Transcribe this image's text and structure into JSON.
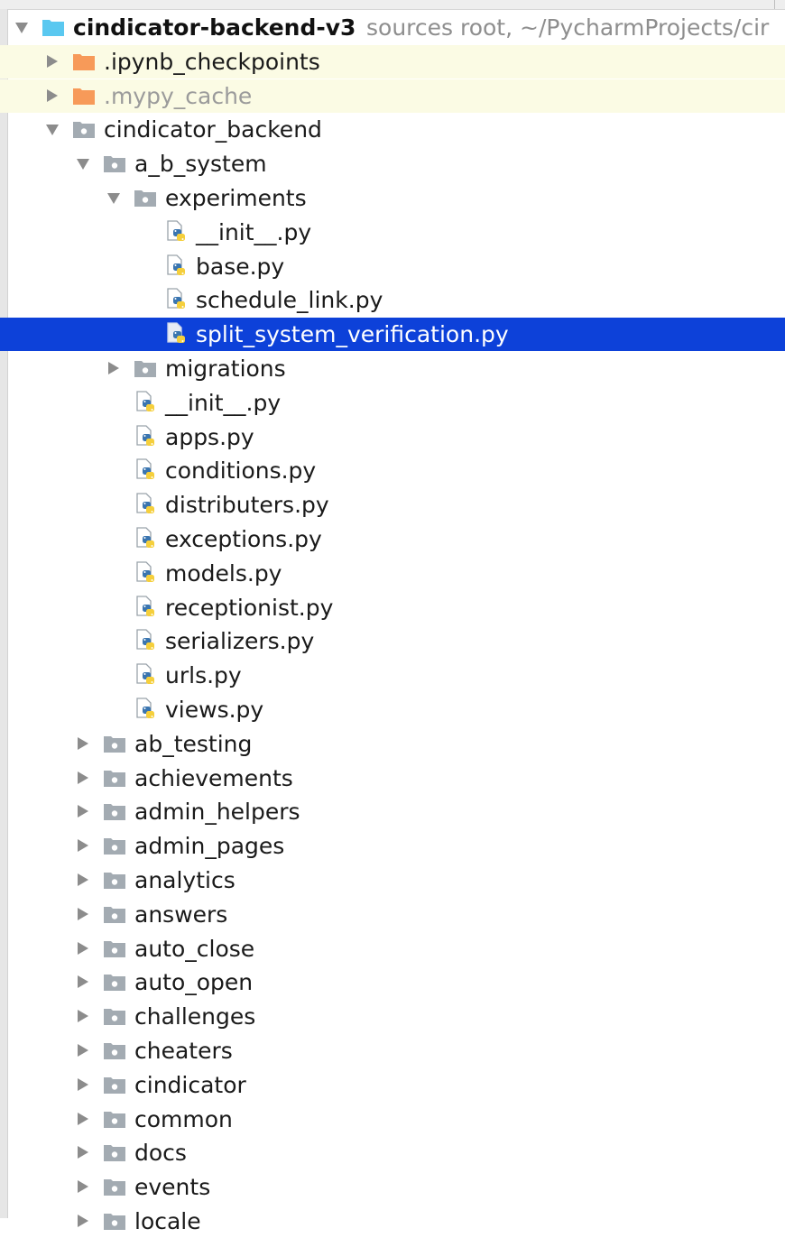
{
  "tree": {
    "rows": [
      {
        "depth": 0,
        "label": "cindicator-backend-v3",
        "hint": "sources root, ~/PycharmProjects/cir",
        "kind": "root",
        "expanded": true
      },
      {
        "depth": 1,
        "label": ".ipynb_checkpoints",
        "kind": "excluded",
        "expanded": false
      },
      {
        "depth": 1,
        "label": ".mypy_cache",
        "kind": "excluded",
        "expanded": false,
        "muted": true
      },
      {
        "depth": 1,
        "label": "cindicator_backend",
        "kind": "folder",
        "expanded": true
      },
      {
        "depth": 2,
        "label": "a_b_system",
        "kind": "folder",
        "expanded": true
      },
      {
        "depth": 3,
        "label": "experiments",
        "kind": "folder",
        "expanded": true
      },
      {
        "depth": 4,
        "label": "__init__.py",
        "kind": "file"
      },
      {
        "depth": 4,
        "label": "base.py",
        "kind": "file"
      },
      {
        "depth": 4,
        "label": "schedule_link.py",
        "kind": "file"
      },
      {
        "depth": 4,
        "label": "split_system_verification.py",
        "kind": "file",
        "selected": true
      },
      {
        "depth": 3,
        "label": "migrations",
        "kind": "folder",
        "expanded": false
      },
      {
        "depth": 3,
        "label": "__init__.py",
        "kind": "file"
      },
      {
        "depth": 3,
        "label": "apps.py",
        "kind": "file"
      },
      {
        "depth": 3,
        "label": "conditions.py",
        "kind": "file"
      },
      {
        "depth": 3,
        "label": "distributers.py",
        "kind": "file"
      },
      {
        "depth": 3,
        "label": "exceptions.py",
        "kind": "file"
      },
      {
        "depth": 3,
        "label": "models.py",
        "kind": "file"
      },
      {
        "depth": 3,
        "label": "receptionist.py",
        "kind": "file"
      },
      {
        "depth": 3,
        "label": "serializers.py",
        "kind": "file"
      },
      {
        "depth": 3,
        "label": "urls.py",
        "kind": "file"
      },
      {
        "depth": 3,
        "label": "views.py",
        "kind": "file"
      },
      {
        "depth": 2,
        "label": "ab_testing",
        "kind": "folder",
        "expanded": false
      },
      {
        "depth": 2,
        "label": "achievements",
        "kind": "folder",
        "expanded": false
      },
      {
        "depth": 2,
        "label": "admin_helpers",
        "kind": "folder",
        "expanded": false
      },
      {
        "depth": 2,
        "label": "admin_pages",
        "kind": "folder",
        "expanded": false
      },
      {
        "depth": 2,
        "label": "analytics",
        "kind": "folder",
        "expanded": false
      },
      {
        "depth": 2,
        "label": "answers",
        "kind": "folder",
        "expanded": false
      },
      {
        "depth": 2,
        "label": "auto_close",
        "kind": "folder",
        "expanded": false
      },
      {
        "depth": 2,
        "label": "auto_open",
        "kind": "folder",
        "expanded": false
      },
      {
        "depth": 2,
        "label": "challenges",
        "kind": "folder",
        "expanded": false
      },
      {
        "depth": 2,
        "label": "cheaters",
        "kind": "folder",
        "expanded": false
      },
      {
        "depth": 2,
        "label": "cindicator",
        "kind": "folder",
        "expanded": false
      },
      {
        "depth": 2,
        "label": "common",
        "kind": "folder",
        "expanded": false
      },
      {
        "depth": 2,
        "label": "docs",
        "kind": "folder",
        "expanded": false
      },
      {
        "depth": 2,
        "label": "events",
        "kind": "folder",
        "expanded": false
      },
      {
        "depth": 2,
        "label": "locale",
        "kind": "folder",
        "expanded": false
      }
    ]
  },
  "colors": {
    "selection": "#0d41d9",
    "excluded_row": "#fbfbe4",
    "excluded_folder": "#f79a59",
    "root_folder": "#5ac8f0",
    "folder": "#a3abb2",
    "python_blue": "#3a75b0",
    "python_yellow": "#f5cf3c"
  }
}
